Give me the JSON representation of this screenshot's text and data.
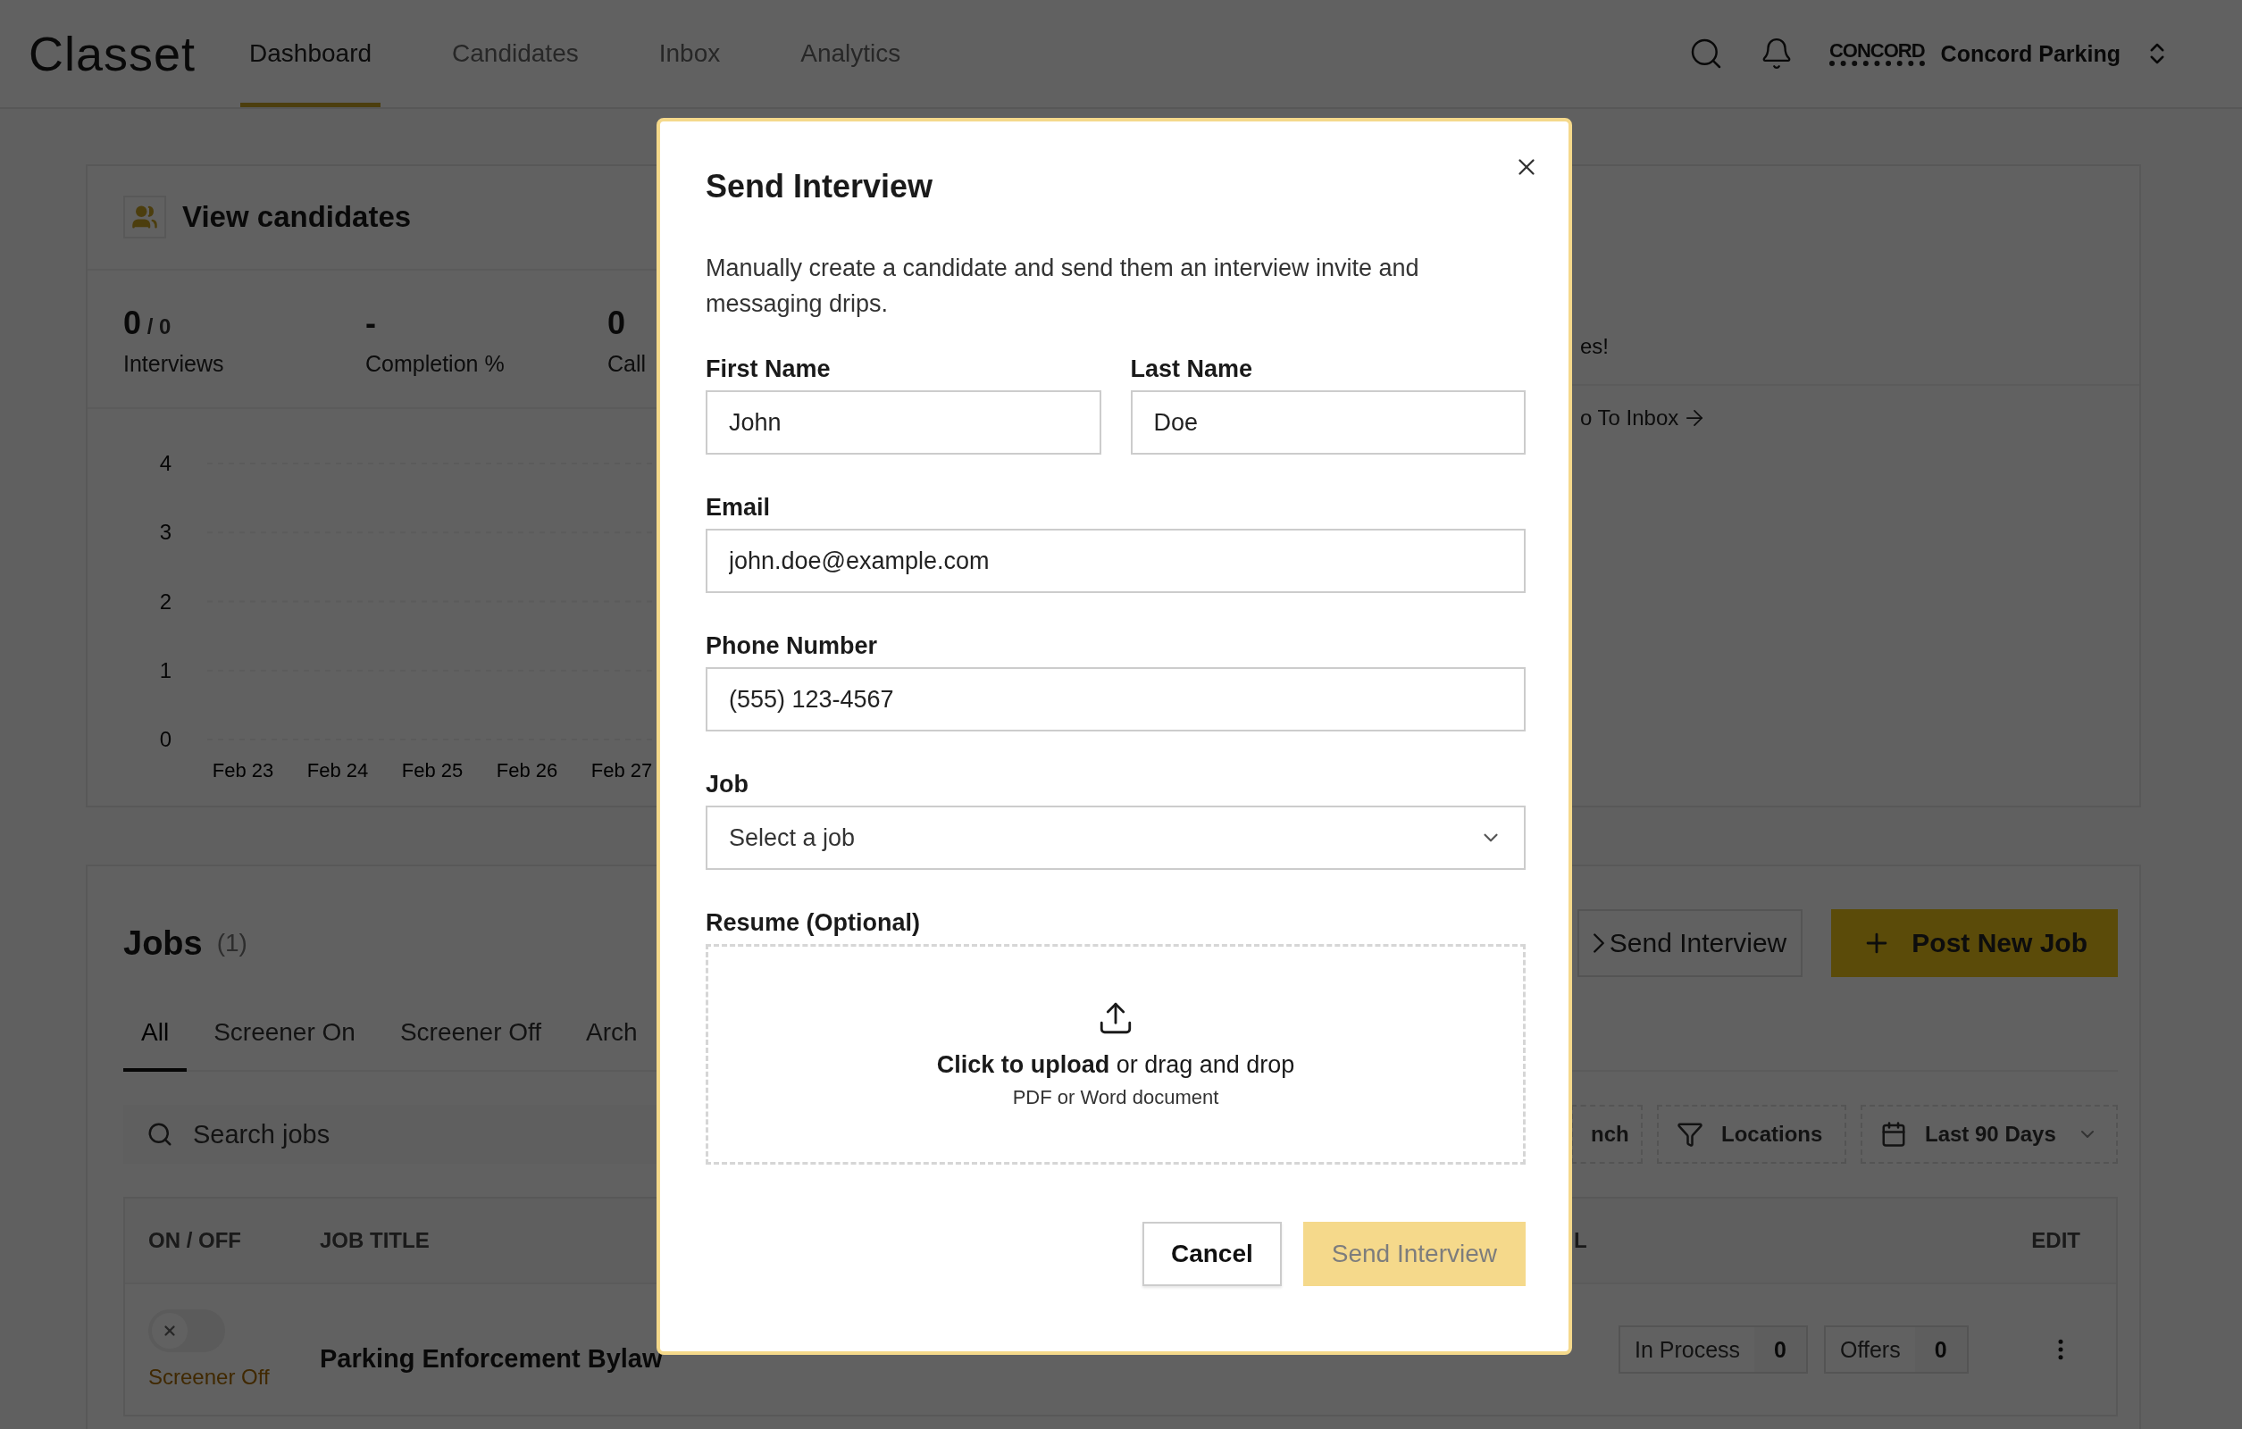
{
  "header": {
    "logo": "Classet",
    "nav": [
      {
        "label": "Dashboard",
        "selected": true
      },
      {
        "label": "Candidates",
        "selected": false
      },
      {
        "label": "Inbox",
        "selected": false
      },
      {
        "label": "Analytics",
        "selected": false
      }
    ],
    "org_logo": "CONCORD",
    "org_name": "Concord Parking"
  },
  "candidates_card": {
    "title": "View candidates",
    "stats": [
      {
        "value": "0",
        "total": "/ 0",
        "label": "Interviews"
      },
      {
        "value": "-",
        "label": "Completion %"
      },
      {
        "value": "0",
        "label": "Call"
      }
    ],
    "chart_data": {
      "type": "line",
      "categories": [
        "Feb 23",
        "Feb 24",
        "Feb 25",
        "Feb 26",
        "Feb 27"
      ],
      "ylim": [
        0,
        4
      ],
      "yticks": [
        0,
        1,
        2,
        3,
        4
      ],
      "grid": true
    }
  },
  "inbox_card": {
    "message": "es!",
    "link": "o To Inbox"
  },
  "jobs": {
    "title": "Jobs",
    "count": "(1)",
    "actions": [
      {
        "label": "Send Interview",
        "kind": "outline"
      },
      {
        "label": "Post New Job",
        "kind": "primary"
      }
    ],
    "tabs": [
      {
        "label": "All",
        "selected": true
      },
      {
        "label": "Screener On",
        "selected": false
      },
      {
        "label": "Screener Off",
        "selected": false
      },
      {
        "label": "Arch",
        "selected": false
      }
    ],
    "search": {
      "placeholder": "Search jobs"
    },
    "filters": [
      {
        "label": "nch",
        "kind": "plain"
      },
      {
        "label": "Locations",
        "kind": "filter"
      },
      {
        "label": "Last 90 Days",
        "kind": "date"
      }
    ],
    "table": {
      "columns": [
        "ON / OFF",
        "JOB TITLE",
        "L",
        "EDIT"
      ],
      "rows": [
        {
          "screener_on": false,
          "status": "Screener Off",
          "title": "Parking Enforcement Bylaw",
          "counts": [
            {
              "label": "In Process",
              "value": "0"
            },
            {
              "label": "Offers",
              "value": "0"
            }
          ]
        }
      ]
    }
  },
  "modal": {
    "title": "Send Interview",
    "description": "Manually create a candidate and send them an interview invite and messaging drips.",
    "fields": [
      {
        "label": "First Name",
        "value": "John",
        "kind": "text"
      },
      {
        "label": "Last Name",
        "value": "Doe",
        "kind": "text"
      },
      {
        "label": "Email",
        "value": "john.doe@example.com",
        "kind": "text"
      },
      {
        "label": "Phone Number",
        "value": "(555) 123-4567",
        "kind": "text"
      },
      {
        "label": "Job",
        "placeholder": "Select a job",
        "kind": "select"
      }
    ],
    "resume": {
      "label": "Resume (Optional)",
      "prompt": "**Click to upload** or drag and drop",
      "hint": "PDF or Word document"
    },
    "buttons": [
      {
        "label": "Cancel",
        "kind": "secondary",
        "disabled": false
      },
      {
        "label": "Send Interview",
        "kind": "primary",
        "disabled": true
      }
    ]
  }
}
